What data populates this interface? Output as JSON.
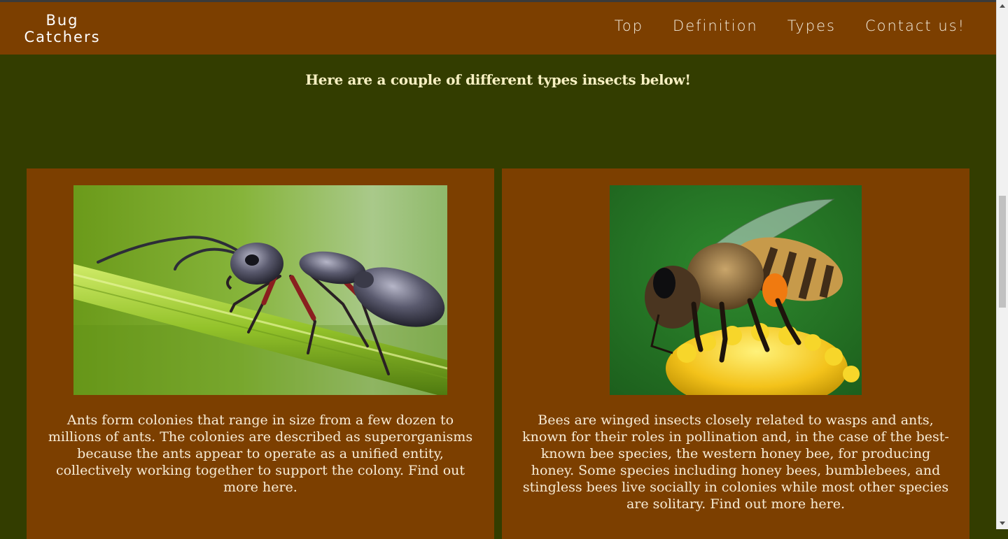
{
  "nav": {
    "brand": "Bug Catchers",
    "links": [
      "Top",
      "Definition",
      "Types",
      "Contact us!"
    ]
  },
  "heading": "Here are a couple of different types insects below!",
  "cards": [
    {
      "image": "ant-photo",
      "text": "Ants form colonies that range in size from a few dozen to millions of ants. The colonies are described as superorganisms because the ants appear to operate as a unified entity, collectively working together to support the colony. Find out more here."
    },
    {
      "image": "bee-photo",
      "text": "Bees are winged insects closely related to wasps and ants, known for their roles in pollination and, in the case of the best-known bee species, the western honey bee, for producing honey. Some species including honey bees, bumblebees, and stingless bees live socially in colonies while most other species are solitary. Find out more here."
    }
  ],
  "colors": {
    "background": "#333d00",
    "navbar": "#7c3f00",
    "card": "#7c3f00",
    "heading_text": "#f7f0c2"
  }
}
